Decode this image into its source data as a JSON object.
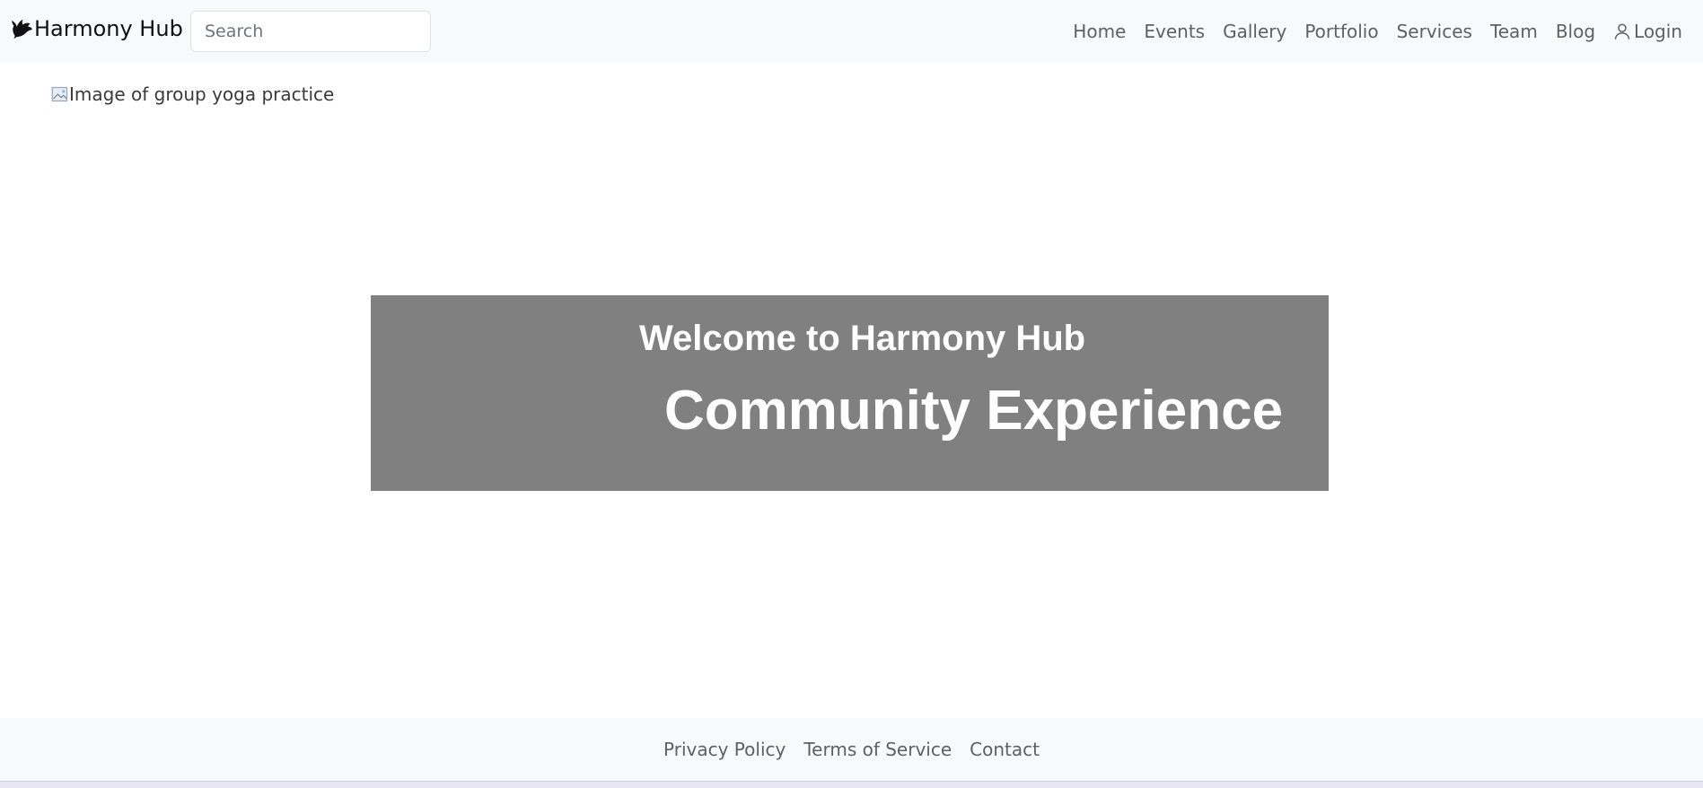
{
  "navbar": {
    "brand": {
      "icon": "bird-icon",
      "label": "Harmony Hub"
    },
    "search": {
      "placeholder": "Search",
      "value": ""
    },
    "links": [
      {
        "label": "Home"
      },
      {
        "label": "Events"
      },
      {
        "label": "Gallery"
      },
      {
        "label": "Portfolio"
      },
      {
        "label": "Services"
      },
      {
        "label": "Team"
      },
      {
        "label": "Blog"
      },
      {
        "label": "Login",
        "icon": "person-icon"
      }
    ]
  },
  "main": {
    "image_alt": "Image of group yoga practice",
    "hero": {
      "welcome": "Welcome to Harmony Hub",
      "title": "Community Experience",
      "background": "#808080",
      "text_color": "#ffffff"
    }
  },
  "footer": {
    "links": [
      {
        "label": "Privacy Policy"
      },
      {
        "label": "Terms of Service"
      },
      {
        "label": "Contact"
      }
    ]
  },
  "colors": {
    "navbar_bg": "#f8f9fa",
    "nav_link": "#5c6166",
    "brand_text": "#111111"
  }
}
